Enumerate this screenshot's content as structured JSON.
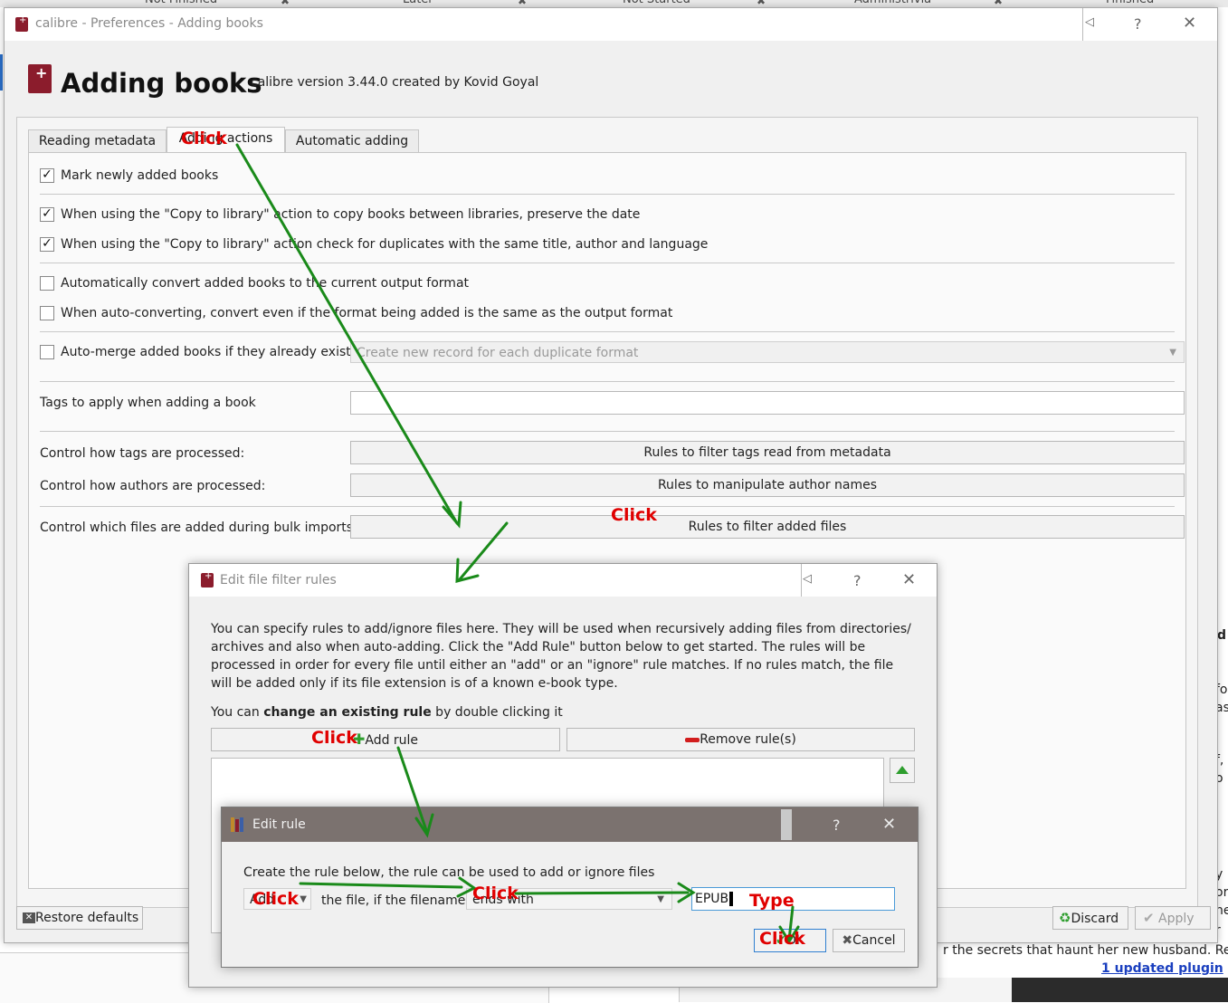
{
  "background": {
    "tabs": [
      {
        "label": "Not Finished"
      },
      {
        "label": "Later"
      },
      {
        "label": "Not Started"
      },
      {
        "label": "Administrivia"
      },
      {
        "label": "Finished"
      }
    ],
    "right_fragments": [
      "d",
      "fo",
      "as",
      "f,",
      "o",
      "y",
      "or",
      "he",
      "r"
    ],
    "bottom_text": "r the secrets that haunt her new husband. Read",
    "plugin_link": "1 updated plugin"
  },
  "pref_window": {
    "title": "calibre - Preferences - Adding books",
    "heading": "Adding books",
    "version": "calibre version 3.44.0 created by Kovid Goyal",
    "tabs": [
      {
        "label": "Reading metadata",
        "active": false
      },
      {
        "label": "Adding actions",
        "active": true
      },
      {
        "label": "Automatic adding",
        "active": false
      }
    ],
    "options": {
      "mark_new": {
        "label": "Mark newly added books",
        "checked": true
      },
      "copy_preserve_date": {
        "label": "When using the  \"Copy to library\" action to copy books between libraries, preserve the date",
        "checked": true
      },
      "copy_check_dups": {
        "label": "When using the \"Copy to library\" action check for duplicates with the same title, author and language",
        "checked": true
      },
      "auto_convert": {
        "label": "Automatically convert added books to the current output format",
        "checked": false
      },
      "convert_same": {
        "label": "When auto-converting, convert even if the format being added is the same as the output format",
        "checked": false
      },
      "auto_merge": {
        "label": "Auto-merge added books if they already exist:",
        "checked": false,
        "select_value": "Create new record for each duplicate format"
      }
    },
    "tags_label": "Tags to apply when adding a book",
    "tags_value": "",
    "tags_processing_label": "Control how tags are processed:",
    "tags_processing_button": "Rules to filter tags read from metadata",
    "authors_processing_label": "Control how authors are processed:",
    "authors_processing_button": "Rules to manipulate author names",
    "files_processing_label": "Control which files are added during bulk imports:",
    "files_processing_button": "Rules to filter added files",
    "restore_defaults": "Restore defaults",
    "discard": "Discard",
    "apply": "Apply"
  },
  "filter_dialog": {
    "title": "Edit file filter rules",
    "description": "You can specify rules to add/ignore files here. They will be used when recursively adding files from directories/ archives and also when auto-adding. Click the \"Add Rule\" button below to get started. The rules will be processed in order for every file until either an \"add\" or an \"ignore\" rule matches. If no rules match, the file will be added only if its file extension is of a known e-book type.",
    "hint_prefix": "You can ",
    "hint_bold": "change an existing rule",
    "hint_suffix": " by double clicking it",
    "add_rule": "Add rule",
    "remove_rules": "Remove rule(s)"
  },
  "rule_dialog": {
    "title": "Edit rule",
    "instruction": "Create the rule below, the rule can be used to add or ignore files",
    "action_value": "Add",
    "middle_text": "the file, if the filename",
    "condition_value": "ends with",
    "pattern_value": "EPUB",
    "ok": "OK",
    "cancel": "Cancel"
  },
  "annotations": {
    "click": "Click",
    "type": "Type"
  },
  "colors": {
    "annotation_red": "#e00000",
    "arrow_green": "#1a8a1a",
    "calibre_red": "#8b1c2c"
  }
}
